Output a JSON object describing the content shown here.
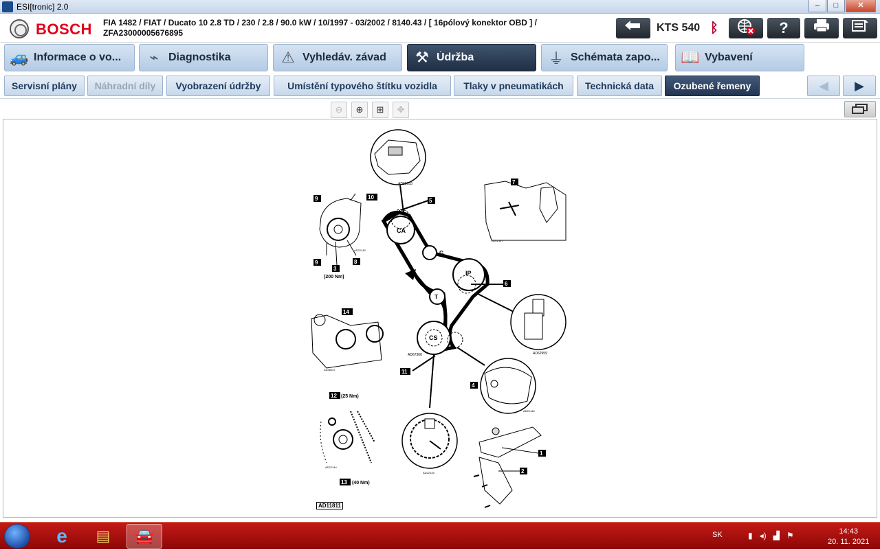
{
  "window": {
    "title": "ESI[tronic] 2.0",
    "buttons": [
      "–",
      "□",
      "✕"
    ]
  },
  "header": {
    "brand": "BOSCH",
    "vehicle_line1": "FIA 1482 / FIAT / Ducato 10 2.8 TD / 230 / 2.8 / 90.0 kW / 10/1997 - 03/2002 / 8140.43 / [ 16pólový konektor OBD ] /",
    "vehicle_line2": "ZFA23000005676895",
    "device": "KTS 540"
  },
  "main_tabs": [
    {
      "label": "Informace o vo...",
      "icon": "vehicle-info-icon"
    },
    {
      "label": "Diagnostika",
      "icon": "diagnostic-plug-icon"
    },
    {
      "label": "Vyhledáv. závad",
      "icon": "fault-search-icon"
    },
    {
      "label": "Údržba",
      "icon": "maintenance-wrench-icon"
    },
    {
      "label": "Schémata zapo...",
      "icon": "wiring-diagram-icon"
    },
    {
      "label": "Vybavení",
      "icon": "book-icon"
    }
  ],
  "sub_tabs": [
    "Servisní plány",
    "Náhradní díly",
    "Vyobrazení údržby",
    "Umístění typového štítku vozidla",
    "Tlaky v pneumatikách",
    "Technická data",
    "Ozubené řemeny"
  ],
  "diagram": {
    "code": "AD11811",
    "labels": {
      "ca": "CA",
      "ip": "IP",
      "cs": "CS",
      "t": "T",
      "g": "G",
      "n1": "1",
      "n2": "2",
      "n3": "3",
      "n4": "4",
      "n5": "5",
      "n6": "6",
      "n7": "7",
      "n8": "8",
      "n9a": "9",
      "n9b": "9",
      "n10": "10",
      "n11": "11",
      "n12": "12",
      "n13": "13",
      "n14": "14",
      "torque_200": "(200 Nm)",
      "torque_25": "(25 Nm)",
      "torque_40": "(40 Nm)",
      "ref_top": "AD62053",
      "ref_pump": "AD22143",
      "ref_7": "AD22147",
      "ref_6": "AD62959",
      "ref_14": "AD48137",
      "ref_cs": "AD67366",
      "ref_4": "AD22146",
      "ref_12": "AD22144",
      "ref_bottom": "AD22145"
    }
  },
  "taskbar": {
    "lang": "SK",
    "time": "14:43",
    "date": "20. 11. 2021"
  }
}
